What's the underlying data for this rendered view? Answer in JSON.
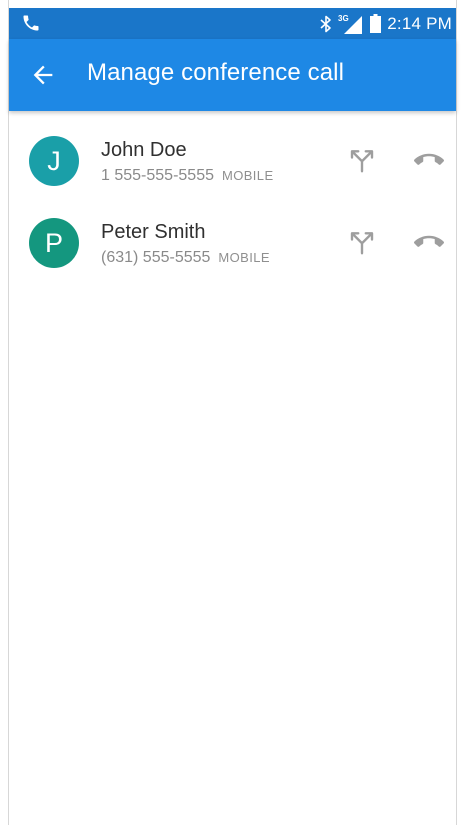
{
  "status_bar": {
    "time": "2:14 PM",
    "network_label": "3G",
    "icons": [
      "phone-call-icon",
      "bluetooth-icon",
      "signal-icon",
      "battery-icon"
    ]
  },
  "app_bar": {
    "title": "Manage conference call",
    "back_icon": "arrow-back-icon"
  },
  "participants": [
    {
      "initial": "J",
      "name": "John Doe",
      "number": "1 555-555-5555",
      "type": "MOBILE",
      "avatar_color": "#1a9fa8",
      "actions": [
        "split-call-icon",
        "end-call-icon"
      ]
    },
    {
      "initial": "P",
      "name": "Peter Smith",
      "number": "(631) 555-5555",
      "type": "MOBILE",
      "avatar_color": "#14977f",
      "actions": [
        "split-call-icon",
        "end-call-icon"
      ]
    }
  ],
  "colors": {
    "status_bar": "#1a76c9",
    "app_bar": "#1e88e5",
    "action_icon": "#9e9e9e"
  }
}
